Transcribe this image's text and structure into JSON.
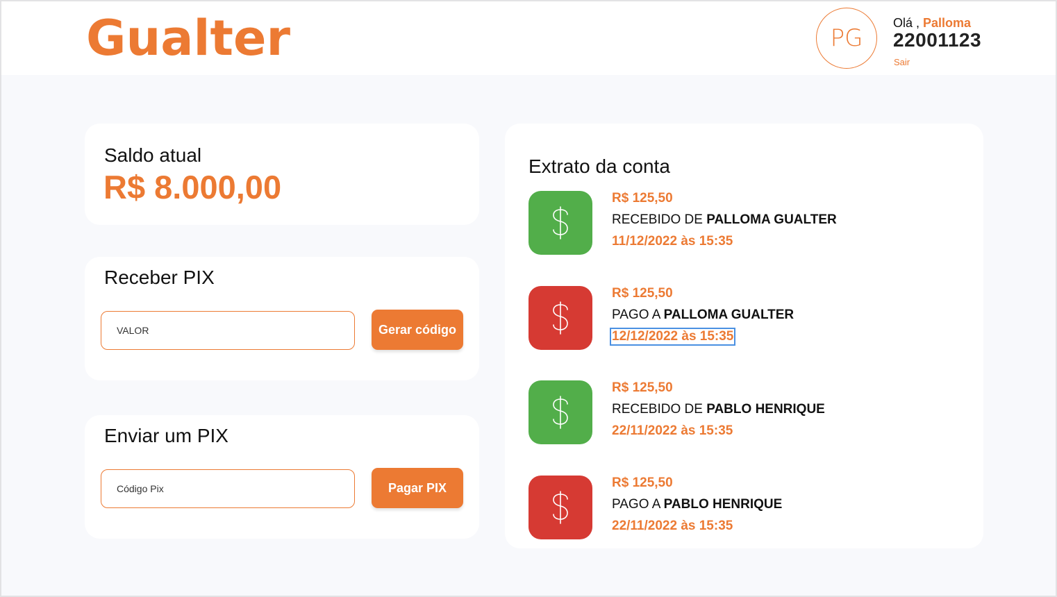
{
  "header": {
    "logo": "Gualter",
    "avatar_initials": "PG",
    "greeting_prefix": "Olá ,",
    "user_name": "Palloma",
    "account_number": "22001123",
    "logout_label": "Sair"
  },
  "balance": {
    "label": "Saldo atual",
    "value": "R$ 8.000,00"
  },
  "receive_pix": {
    "title": "Receber PIX",
    "input_placeholder": "VALOR",
    "button_label": "Gerar código"
  },
  "send_pix": {
    "title": "Enviar um PIX",
    "input_placeholder": "Código Pix",
    "button_label": "Pagar PIX"
  },
  "statement": {
    "title": "Extrato da conta",
    "transactions": [
      {
        "type": "in",
        "icon": "dollar-icon",
        "amount": "R$ 125,50",
        "action": "RECEBIDO DE",
        "party": "PALLOMA GUALTER",
        "date": "11/12/2022 às 15:35"
      },
      {
        "type": "out",
        "icon": "dollar-icon",
        "amount": "R$ 125,50",
        "action": "PAGO A",
        "party": "PALLOMA GUALTER",
        "date": "12/12/2022 às 15:35"
      },
      {
        "type": "in",
        "icon": "dollar-icon",
        "amount": "R$ 125,50",
        "action": "RECEBIDO DE",
        "party": "PABLO HENRIQUE",
        "date": "22/11/2022 às 15:35"
      },
      {
        "type": "out",
        "icon": "dollar-icon",
        "amount": "R$ 125,50",
        "action": "PAGO A",
        "party": "PABLO HENRIQUE",
        "date": "22/11/2022 às 15:35"
      }
    ]
  },
  "colors": {
    "brand": "#ec7a33",
    "received": "#52ae4a",
    "paid": "#d63a33",
    "background": "#f8f9fc"
  }
}
